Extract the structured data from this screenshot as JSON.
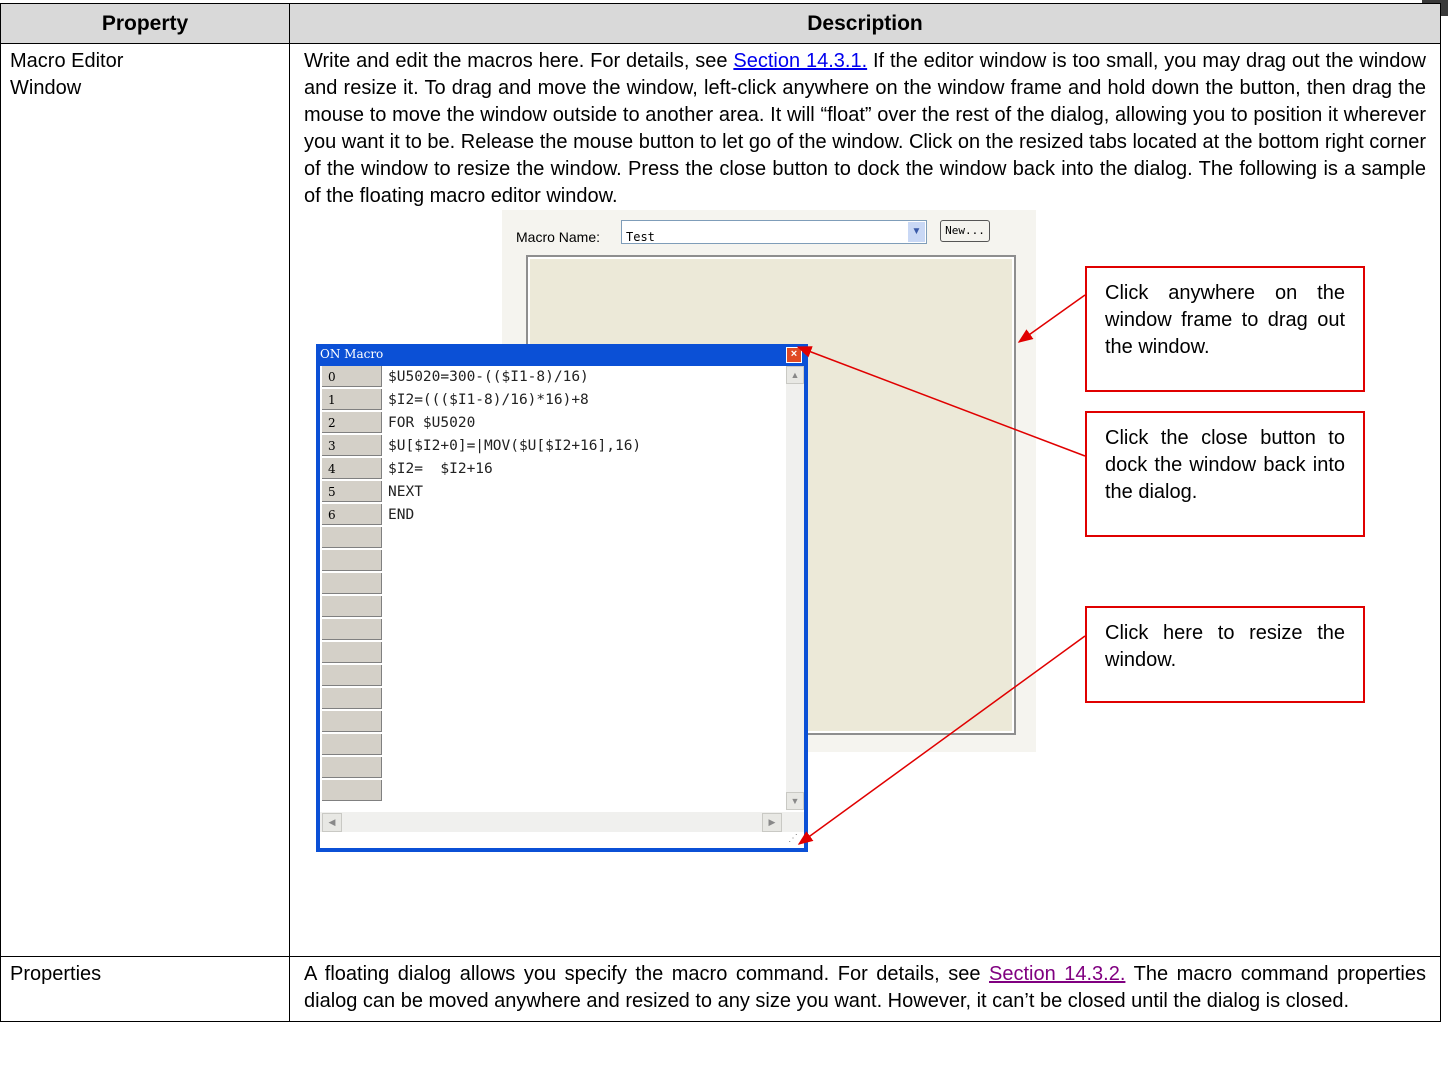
{
  "table": {
    "headers": {
      "property": "Property",
      "description": "Description"
    },
    "row1": {
      "property_line1": "Macro Editor",
      "property_line2": "Window",
      "desc_before": "Write and edit the macros here. For details, see ",
      "desc_link": "Section 14.3.1.",
      "desc_after": " If the editor window is too small, you may drag out the window and resize it. To drag and move the window, left-click anywhere on the window frame and hold down the button, then drag the mouse to move the window outside to another area. It will “float” over the rest of the dialog, allowing you to position it wherever you want it to be. Release the mouse button to let go of the window. Click on the resized tabs located at the bottom right corner of the window to resize the window. Press the close button to dock the window back into the dialog. The following is a sample of the floating macro editor window."
    },
    "row2": {
      "property": "Properties",
      "desc_before": "A floating dialog allows you specify the macro command. For details, see ",
      "desc_link": "Section 14.3.2.",
      "desc_after": " The macro command properties dialog can be moved anywhere and resized to any size you want. However, it can’t be closed until the dialog is closed."
    }
  },
  "figure": {
    "dialog": {
      "macro_name_label": "Macro Name:",
      "macro_name_value": "Test",
      "new_button": "New..."
    },
    "window": {
      "title": "ON Macro",
      "line_numbers": [
        "0",
        "1",
        "2",
        "3",
        "4",
        "5",
        "6"
      ],
      "code_lines": [
        "$U5020=300-(($I1-8)/16)",
        "$I2=((($I1-8)/16)*16)+8",
        "FOR $U5020",
        "$U[$I2+0]=|MOV($U[$I2+16],16)",
        "$I2=  $I2+16",
        "NEXT",
        "END"
      ]
    },
    "callouts": {
      "drag": "Click anywhere on the window frame to drag out the window.",
      "close": "Click the close button to dock the window back into the dialog.",
      "resize": "Click here to resize the window."
    },
    "colors": {
      "callout_border": "#e00000",
      "window_frame": "#0b50d6",
      "header_bg": "#d9d9d9",
      "link": "#0000ee",
      "visited_link": "#800080"
    }
  }
}
